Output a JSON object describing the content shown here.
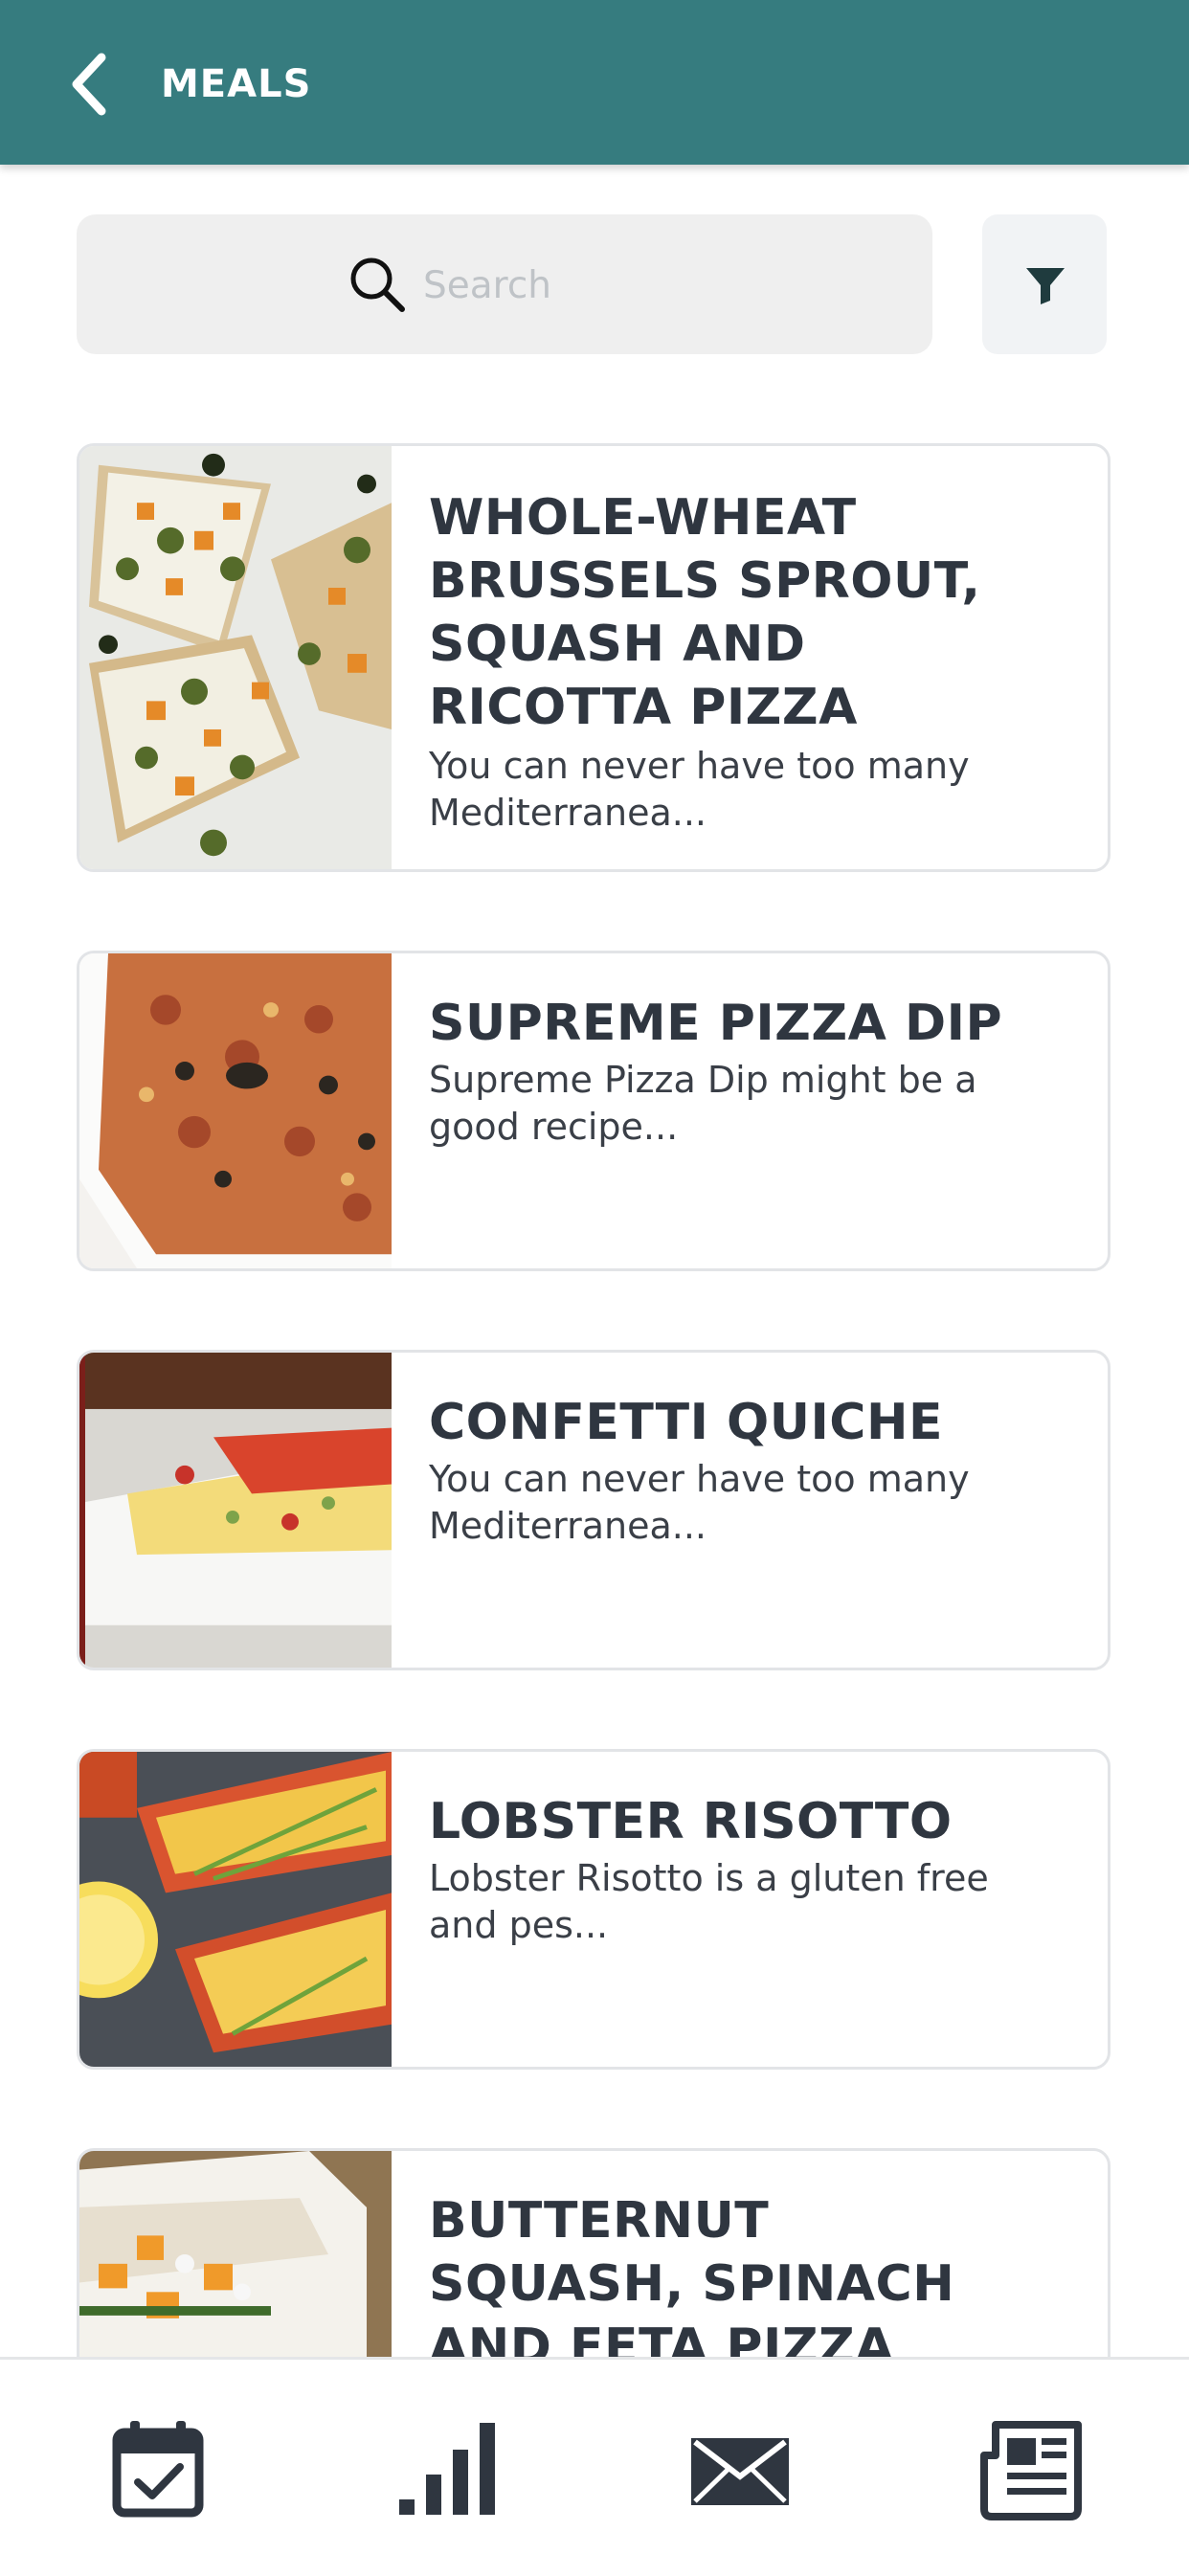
{
  "header": {
    "title": "MEALS",
    "back_icon": "chevron-left-icon"
  },
  "search": {
    "placeholder": "Search",
    "value": "",
    "icon": "search-icon"
  },
  "filter": {
    "icon": "filter-icon"
  },
  "meals": [
    {
      "title": "WHOLE-WHEAT BRUSSELS SPROUT, SQUASH AND RICOTTA PIZZA",
      "description": "You can never have too many Mediterranea..."
    },
    {
      "title": "SUPREME PIZZA DIP",
      "description": "Supreme Pizza Dip might be a good recipe..."
    },
    {
      "title": "CONFETTI QUICHE",
      "description": "You can never have too many Mediterranea..."
    },
    {
      "title": "LOBSTER RISOTTO",
      "description": "Lobster Risotto is a gluten free and pes..."
    },
    {
      "title": "BUTTERNUT SQUASH, SPINACH AND FETA PIZZA",
      "description": ""
    }
  ],
  "bottom_nav": [
    {
      "icon": "calendar-check-icon"
    },
    {
      "icon": "bar-chart-icon"
    },
    {
      "icon": "mail-icon"
    },
    {
      "icon": "newspaper-icon"
    }
  ],
  "colors": {
    "header_bg": "#367c7f",
    "card_border": "#e2e4e7",
    "text_dark": "#2f3640",
    "search_bg": "#efefef"
  }
}
